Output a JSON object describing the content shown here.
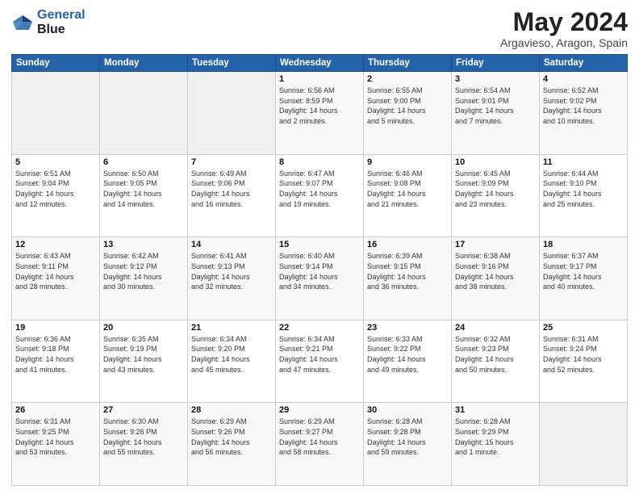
{
  "header": {
    "logo_line1": "General",
    "logo_line2": "Blue",
    "title": "May 2024",
    "subtitle": "Argavieso, Aragon, Spain"
  },
  "weekdays": [
    "Sunday",
    "Monday",
    "Tuesday",
    "Wednesday",
    "Thursday",
    "Friday",
    "Saturday"
  ],
  "weeks": [
    [
      {
        "day": "",
        "info": ""
      },
      {
        "day": "",
        "info": ""
      },
      {
        "day": "",
        "info": ""
      },
      {
        "day": "1",
        "info": "Sunrise: 6:56 AM\nSunset: 8:59 PM\nDaylight: 14 hours\nand 2 minutes."
      },
      {
        "day": "2",
        "info": "Sunrise: 6:55 AM\nSunset: 9:00 PM\nDaylight: 14 hours\nand 5 minutes."
      },
      {
        "day": "3",
        "info": "Sunrise: 6:54 AM\nSunset: 9:01 PM\nDaylight: 14 hours\nand 7 minutes."
      },
      {
        "day": "4",
        "info": "Sunrise: 6:52 AM\nSunset: 9:02 PM\nDaylight: 14 hours\nand 10 minutes."
      }
    ],
    [
      {
        "day": "5",
        "info": "Sunrise: 6:51 AM\nSunset: 9:04 PM\nDaylight: 14 hours\nand 12 minutes."
      },
      {
        "day": "6",
        "info": "Sunrise: 6:50 AM\nSunset: 9:05 PM\nDaylight: 14 hours\nand 14 minutes."
      },
      {
        "day": "7",
        "info": "Sunrise: 6:49 AM\nSunset: 9:06 PM\nDaylight: 14 hours\nand 16 minutes."
      },
      {
        "day": "8",
        "info": "Sunrise: 6:47 AM\nSunset: 9:07 PM\nDaylight: 14 hours\nand 19 minutes."
      },
      {
        "day": "9",
        "info": "Sunrise: 6:46 AM\nSunset: 9:08 PM\nDaylight: 14 hours\nand 21 minutes."
      },
      {
        "day": "10",
        "info": "Sunrise: 6:45 AM\nSunset: 9:09 PM\nDaylight: 14 hours\nand 23 minutes."
      },
      {
        "day": "11",
        "info": "Sunrise: 6:44 AM\nSunset: 9:10 PM\nDaylight: 14 hours\nand 25 minutes."
      }
    ],
    [
      {
        "day": "12",
        "info": "Sunrise: 6:43 AM\nSunset: 9:11 PM\nDaylight: 14 hours\nand 28 minutes."
      },
      {
        "day": "13",
        "info": "Sunrise: 6:42 AM\nSunset: 9:12 PM\nDaylight: 14 hours\nand 30 minutes."
      },
      {
        "day": "14",
        "info": "Sunrise: 6:41 AM\nSunset: 9:13 PM\nDaylight: 14 hours\nand 32 minutes."
      },
      {
        "day": "15",
        "info": "Sunrise: 6:40 AM\nSunset: 9:14 PM\nDaylight: 14 hours\nand 34 minutes."
      },
      {
        "day": "16",
        "info": "Sunrise: 6:39 AM\nSunset: 9:15 PM\nDaylight: 14 hours\nand 36 minutes."
      },
      {
        "day": "17",
        "info": "Sunrise: 6:38 AM\nSunset: 9:16 PM\nDaylight: 14 hours\nand 38 minutes."
      },
      {
        "day": "18",
        "info": "Sunrise: 6:37 AM\nSunset: 9:17 PM\nDaylight: 14 hours\nand 40 minutes."
      }
    ],
    [
      {
        "day": "19",
        "info": "Sunrise: 6:36 AM\nSunset: 9:18 PM\nDaylight: 14 hours\nand 41 minutes."
      },
      {
        "day": "20",
        "info": "Sunrise: 6:35 AM\nSunset: 9:19 PM\nDaylight: 14 hours\nand 43 minutes."
      },
      {
        "day": "21",
        "info": "Sunrise: 6:34 AM\nSunset: 9:20 PM\nDaylight: 14 hours\nand 45 minutes."
      },
      {
        "day": "22",
        "info": "Sunrise: 6:34 AM\nSunset: 9:21 PM\nDaylight: 14 hours\nand 47 minutes."
      },
      {
        "day": "23",
        "info": "Sunrise: 6:33 AM\nSunset: 9:22 PM\nDaylight: 14 hours\nand 49 minutes."
      },
      {
        "day": "24",
        "info": "Sunrise: 6:32 AM\nSunset: 9:23 PM\nDaylight: 14 hours\nand 50 minutes."
      },
      {
        "day": "25",
        "info": "Sunrise: 6:31 AM\nSunset: 9:24 PM\nDaylight: 14 hours\nand 52 minutes."
      }
    ],
    [
      {
        "day": "26",
        "info": "Sunrise: 6:31 AM\nSunset: 9:25 PM\nDaylight: 14 hours\nand 53 minutes."
      },
      {
        "day": "27",
        "info": "Sunrise: 6:30 AM\nSunset: 9:26 PM\nDaylight: 14 hours\nand 55 minutes."
      },
      {
        "day": "28",
        "info": "Sunrise: 6:29 AM\nSunset: 9:26 PM\nDaylight: 14 hours\nand 56 minutes."
      },
      {
        "day": "29",
        "info": "Sunrise: 6:29 AM\nSunset: 9:27 PM\nDaylight: 14 hours\nand 58 minutes."
      },
      {
        "day": "30",
        "info": "Sunrise: 6:28 AM\nSunset: 9:28 PM\nDaylight: 14 hours\nand 59 minutes."
      },
      {
        "day": "31",
        "info": "Sunrise: 6:28 AM\nSunset: 9:29 PM\nDaylight: 15 hours\nand 1 minute."
      },
      {
        "day": "",
        "info": ""
      }
    ]
  ]
}
